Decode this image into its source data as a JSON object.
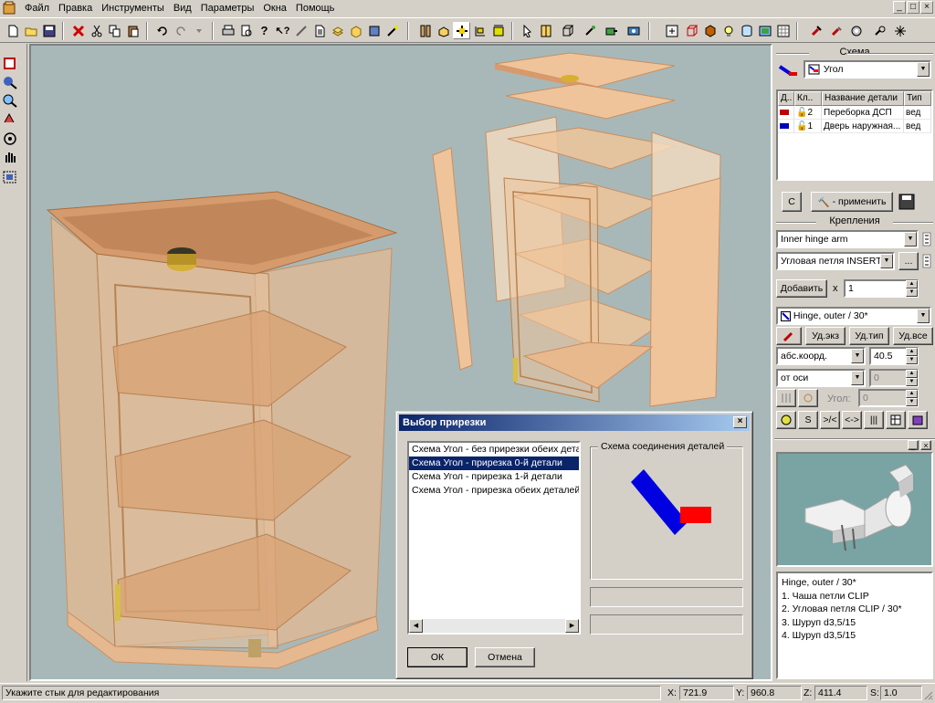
{
  "menu": [
    "Файл",
    "Правка",
    "Инструменты",
    "Вид",
    "Параметры",
    "Окна",
    "Помощь"
  ],
  "window_controls": [
    "_",
    "□",
    "×"
  ],
  "panel": {
    "scheme_title": "Схема",
    "scheme_value": "Угол",
    "grid_headers": [
      "Д..",
      "Кл..",
      "Название детали",
      "Тип"
    ],
    "grid_rows": [
      {
        "color": "#c00000",
        "num": "2",
        "name": "Переборка ДСП",
        "type": "вед"
      },
      {
        "color": "#0000c0",
        "num": "1",
        "name": "Дверь наружная...",
        "type": "вед"
      }
    ],
    "c_button": "С",
    "apply_button": "- применить",
    "fasteners_title": "Крепления",
    "fastener1": "Inner hinge arm",
    "fastener2": "Угловая петля INSERTA /",
    "dots_button": "...",
    "add_button": "Добавить",
    "times_label": "x",
    "count_value": "1",
    "hinge_value": "Hinge, outer /  30*",
    "del_inst": "Уд.экз",
    "del_type": "Уд.тип",
    "del_all": "Уд.все",
    "coord_mode": "абс.коорд.",
    "coord_value": "40.5",
    "axis_mode": "от оси",
    "axis_value": "0",
    "angle_label": "Угол:",
    "angle_value": "0",
    "btn_s": "S",
    "btn_gt": ">/<",
    "btn_lt": "<->",
    "btn_bar": "|||",
    "preview_ctl": [
      "_",
      "×"
    ],
    "desc_lines": [
      "Hinge, outer /  30*",
      "1. Чаша петли CLIP",
      "2. Угловая петля CLIP /  30*",
      "3. Шуруп d3,5/15",
      "4. Шуруп d3,5/15"
    ]
  },
  "dialog": {
    "title": "Выбор прирезки",
    "close": "×",
    "items": [
      "Схема Угол - без прирезки обеих детале",
      "Схема Угол - прирезка 0-й детали",
      "Схема Угол - прирезка 1-й детали",
      "Схема Угол - прирезка обеих деталей"
    ],
    "selected_index": 1,
    "group_label": "Схема соединения деталей",
    "ok": "ОК",
    "cancel": "Отмена"
  },
  "status": {
    "message": "Укажите стык для редактирования",
    "x_label": "X:",
    "x_value": "721.9",
    "y_label": "Y:",
    "y_value": "960.8",
    "z_label": "Z:",
    "z_value": "411.4",
    "s_label": "S:",
    "s_value": "1.0"
  },
  "colors": {
    "wood": "#e9b98e",
    "wood_dark": "#c98f61",
    "viewport_bg": "#a8b8b8",
    "title_bar": "#0a246a",
    "scheme_blue": "#0000e0",
    "scheme_red": "#ff0000"
  },
  "icons": [
    "new-file-icon",
    "open-folder-icon",
    "save-icon",
    "delete-icon",
    "cut-icon",
    "copy-icon",
    "paste-icon",
    "undo-icon",
    "redo-icon",
    "print-icon",
    "print-preview-icon",
    "help-icon",
    "context-help-icon",
    "palette-icon",
    "layers-icon",
    "box-icon",
    "material-icon",
    "magic-wand-icon",
    "panel-icon",
    "part-icon",
    "move-icon",
    "align-icon",
    "select-icon",
    "door-icon",
    "cube-icon",
    "drill-icon",
    "export-icon",
    "camera-icon",
    "render-icon",
    "texture-icon",
    "light-icon",
    "database-icon",
    "view-icon",
    "tool-icon",
    "zoom-icon"
  ]
}
